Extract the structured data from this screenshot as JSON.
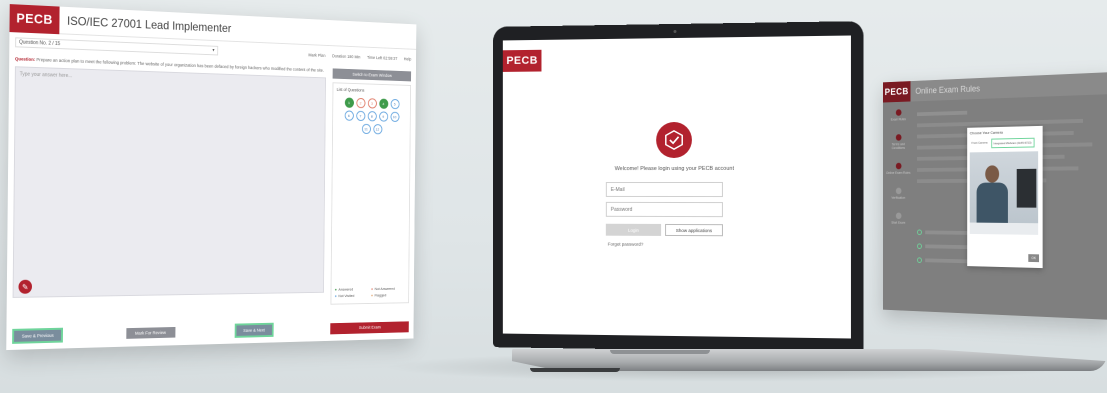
{
  "left_screen": {
    "logo": "PECB",
    "title": "ISO/IEC 27001 Lead Implementer",
    "question_select": "Question No. 2 / 15",
    "meta": [
      "Mark Plan",
      "Duration 180 Min",
      "Time Left 02:59:37",
      "Help"
    ],
    "question_label": "Question:",
    "question_text": "Prepare an action plan to meet the following problem: The website of your organization has been defaced by foreign hackers who modified the content of the site.",
    "answer_placeholder": "Type your answer here...",
    "side_button": "Switch to Exam Window",
    "side_title": "List of Questions",
    "questions": [
      {
        "n": "1",
        "state": "ans"
      },
      {
        "n": "2",
        "state": "mark"
      },
      {
        "n": "3",
        "state": "mark"
      },
      {
        "n": "4",
        "state": "ans"
      },
      {
        "n": "5",
        "state": ""
      },
      {
        "n": "6",
        "state": ""
      },
      {
        "n": "7",
        "state": ""
      },
      {
        "n": "8",
        "state": ""
      },
      {
        "n": "9",
        "state": ""
      },
      {
        "n": "10",
        "state": ""
      },
      {
        "n": "11",
        "state": ""
      },
      {
        "n": "12",
        "state": ""
      }
    ],
    "legend": [
      "Answered",
      "Not Answered",
      "Not Visited",
      "Flagged"
    ],
    "btn_prev": "Save & Previous",
    "btn_review": "Mark For Review",
    "btn_next": "Save & Next",
    "btn_submit": "Submit Exam"
  },
  "laptop": {
    "logo": "PECB",
    "message": "Welcome! Please login using your PECB account",
    "email_placeholder": "E-Mail",
    "password_placeholder": "Password",
    "login_button": "Login",
    "apps_button": "Show applications",
    "forgot": "Forgot password?"
  },
  "right_screen": {
    "logo": "PECB",
    "title": "Online Exam Rules",
    "steps": [
      "Exam Rules",
      "Terms and Conditions",
      "Online Exam Rules",
      "Verification",
      "Start Exam"
    ],
    "modal_title": "Choose Your Camera",
    "modal_tabs": [
      "Front Camera",
      "Integrated Webcam (0c45:6723)"
    ],
    "modal_button": "OK"
  }
}
